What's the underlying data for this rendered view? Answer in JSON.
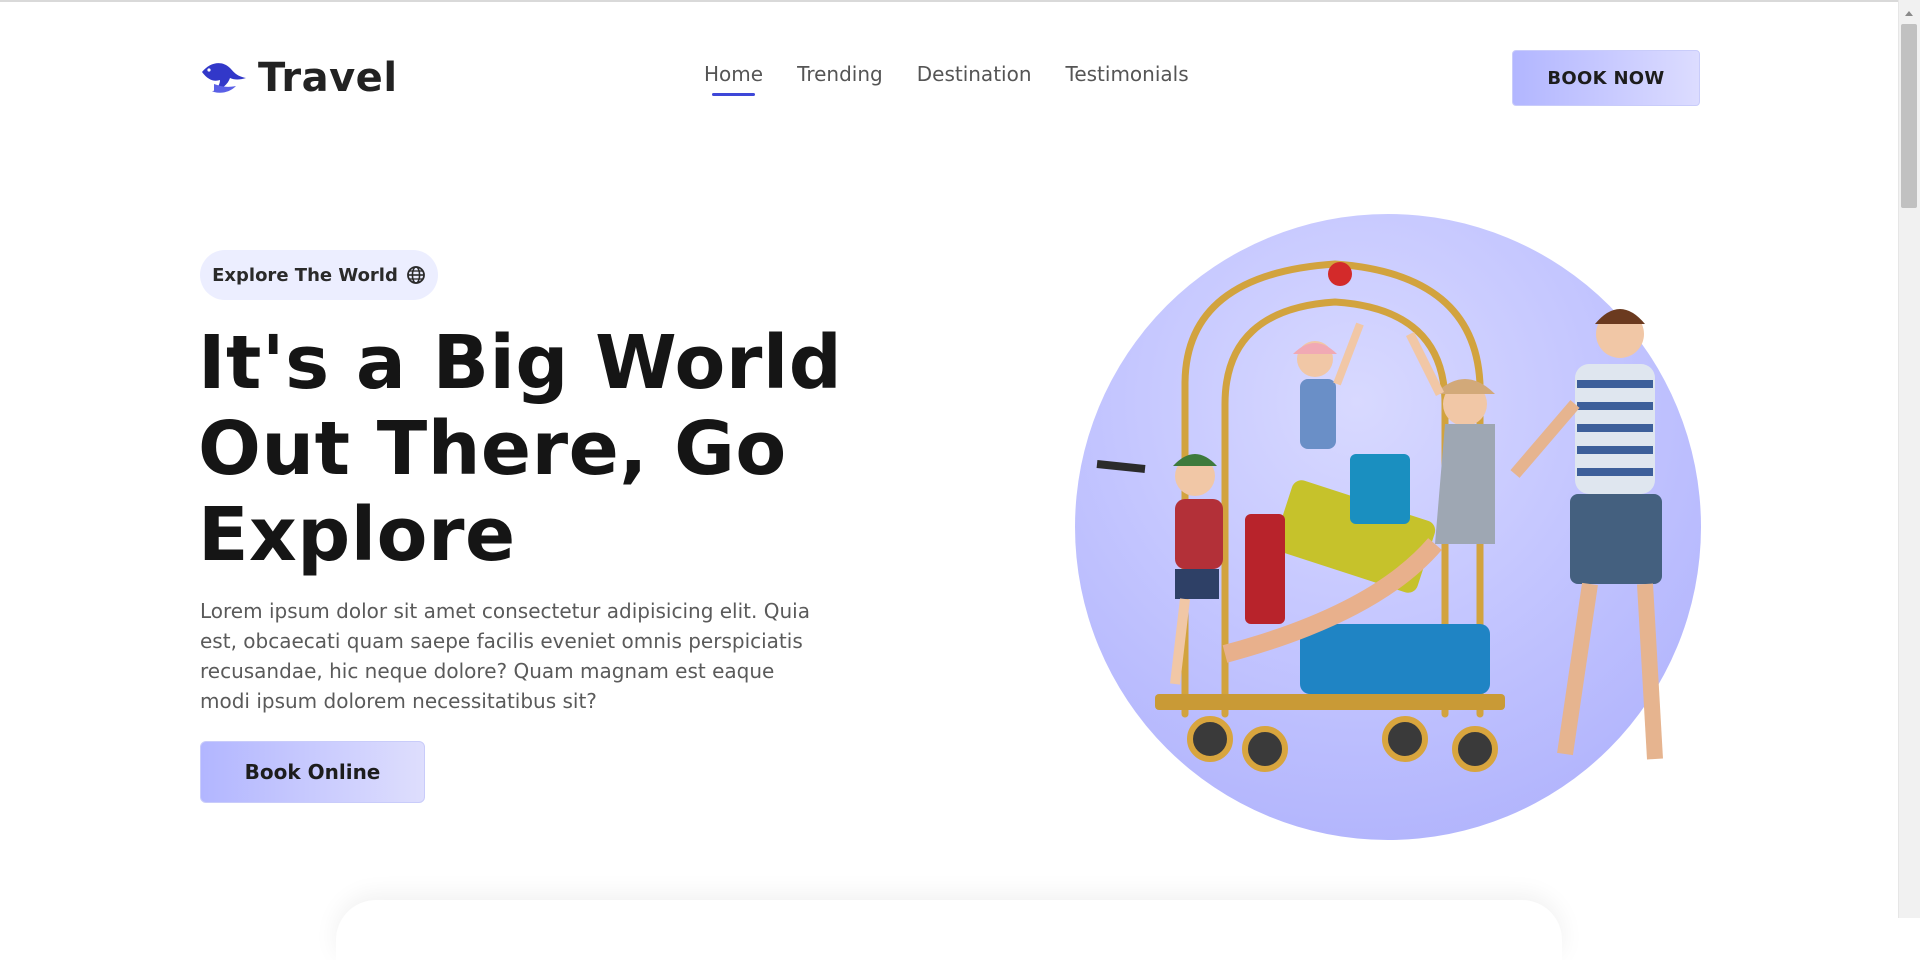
{
  "header": {
    "brand": "Travel",
    "nav": [
      {
        "label": "Home",
        "active": true
      },
      {
        "label": "Trending",
        "active": false
      },
      {
        "label": "Destination",
        "active": false
      },
      {
        "label": "Testimonials",
        "active": false
      }
    ],
    "cta_label": "BOOK NOW"
  },
  "hero": {
    "badge_label": "Explore The World",
    "badge_icon": "globe-icon",
    "headline_lines": [
      "It's a Big World",
      "Out There, Go",
      "Explore"
    ],
    "paragraph": "Lorem ipsum dolor sit amet consectetur adipisicing elit. Quia est, obcaecati quam saepe facilis eveniet omnis perspiciatis recusandae, hic neque dolore? Quam magnam est eaque modi ipsum dolorem necessitatibus sit?",
    "cta_label": "Book Online",
    "image_icon": "family-travel-illustration"
  },
  "colors": {
    "accent": "#3e47d8",
    "button_gradient_start": "#b2b6ff",
    "button_gradient_end": "#dcdcff",
    "pill_bg": "#eceeff",
    "circle": "#c3c5ff"
  }
}
